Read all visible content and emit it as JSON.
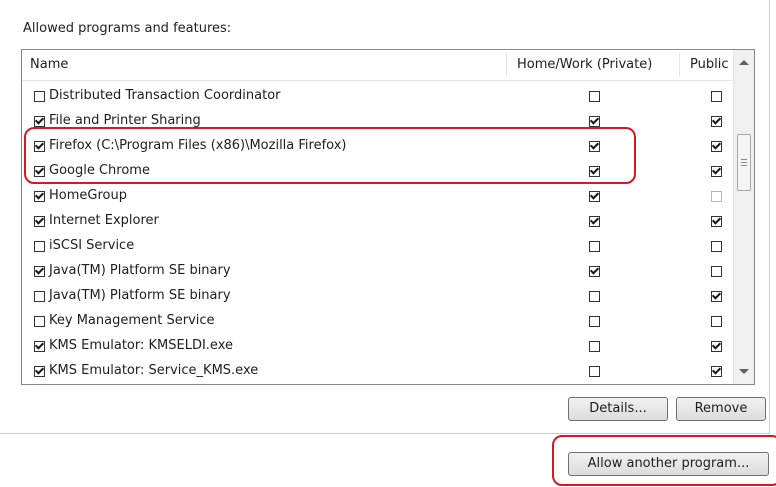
{
  "group_title": "Allowed programs and features:",
  "columns": {
    "name": "Name",
    "private": "Home/Work (Private)",
    "public": "Public"
  },
  "programs": [
    {
      "name": "Distributed Transaction Coordinator",
      "enabled": false,
      "private": false,
      "public": false
    },
    {
      "name": "File and Printer Sharing",
      "enabled": true,
      "private": true,
      "public": true
    },
    {
      "name": "Firefox (C:\\Program Files (x86)\\Mozilla Firefox)",
      "enabled": true,
      "private": true,
      "public": true
    },
    {
      "name": "Google Chrome",
      "enabled": true,
      "private": true,
      "public": true
    },
    {
      "name": "HomeGroup",
      "enabled": true,
      "private": true,
      "public": false,
      "public_disabled": true
    },
    {
      "name": "Internet Explorer",
      "enabled": true,
      "private": true,
      "public": true
    },
    {
      "name": "iSCSI Service",
      "enabled": false,
      "private": false,
      "public": false
    },
    {
      "name": "Java(TM) Platform SE binary",
      "enabled": true,
      "private": true,
      "public": false
    },
    {
      "name": "Java(TM) Platform SE binary",
      "enabled": false,
      "private": false,
      "public": true
    },
    {
      "name": "Key Management Service",
      "enabled": false,
      "private": false,
      "public": false
    },
    {
      "name": "KMS Emulator: KMSELDI.exe",
      "enabled": true,
      "private": false,
      "public": true
    },
    {
      "name": "KMS Emulator: Service_KMS.exe",
      "enabled": true,
      "private": false,
      "public": true
    }
  ],
  "buttons": {
    "details": "Details...",
    "remove": "Remove",
    "allow_another": "Allow another program..."
  },
  "colors": {
    "highlight": "#d11a26",
    "list_border": "#828790"
  }
}
